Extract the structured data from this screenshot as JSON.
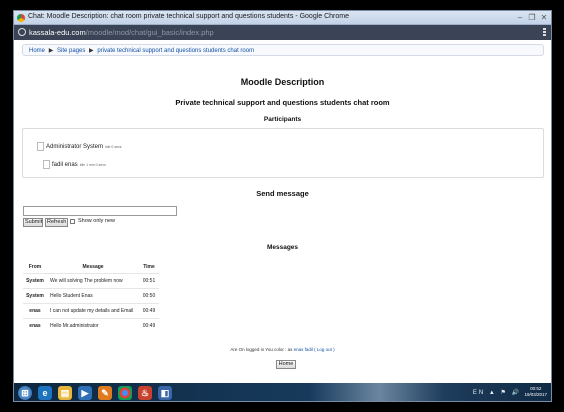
{
  "window": {
    "title": "Chat: Moodle Description: chat room private technical support and questions students - Google Chrome",
    "controls": {
      "minimize": "–",
      "maximize": "❐",
      "close": "✕"
    }
  },
  "address": {
    "host": "kassala-edu.com",
    "path": "/moodle/mod/chat/gui_basic/index.php"
  },
  "breadcrumb": {
    "items": [
      "Home",
      "Site pages",
      "private technical support and questions students chat room"
    ],
    "separator": "▶"
  },
  "page": {
    "heading": "Moodle Description",
    "subheading": "Private technical support and questions students chat room",
    "participants_heading": "Participants"
  },
  "participants": [
    {
      "name": "Administrator System",
      "meta": "idle 0 secs"
    },
    {
      "name": "fadil enas",
      "meta": "idle 1 min 0 secs"
    }
  ],
  "send": {
    "heading": "Send message",
    "input_value": "",
    "submit_label": "Submit",
    "refresh_label": "Refresh",
    "show_new_label": "Show only new",
    "show_new_checked": false
  },
  "messages": {
    "heading": "Messages",
    "columns": [
      "From",
      "Message",
      "Time"
    ],
    "rows": [
      {
        "from": "System",
        "message": "We will solving The problem now",
        "time": "00:51"
      },
      {
        "from": "System",
        "message": "Hello Student Enas",
        "time": "00:50"
      },
      {
        "from": "enas",
        "message": "I can not update my details and Email",
        "time": "00:49"
      },
      {
        "from": "enas",
        "message": "Hello Mr.administrator",
        "time": "00:49"
      }
    ]
  },
  "footer": {
    "login_prefix": "Are On logged in You color : as",
    "user_link": "enas fadil",
    "logout_link": "( Log out )",
    "home_button": "Home"
  },
  "taskbar": {
    "tray_text": "EN ▲ ⚑ 🔊",
    "time": "00:52",
    "date": "19/03/2017"
  }
}
